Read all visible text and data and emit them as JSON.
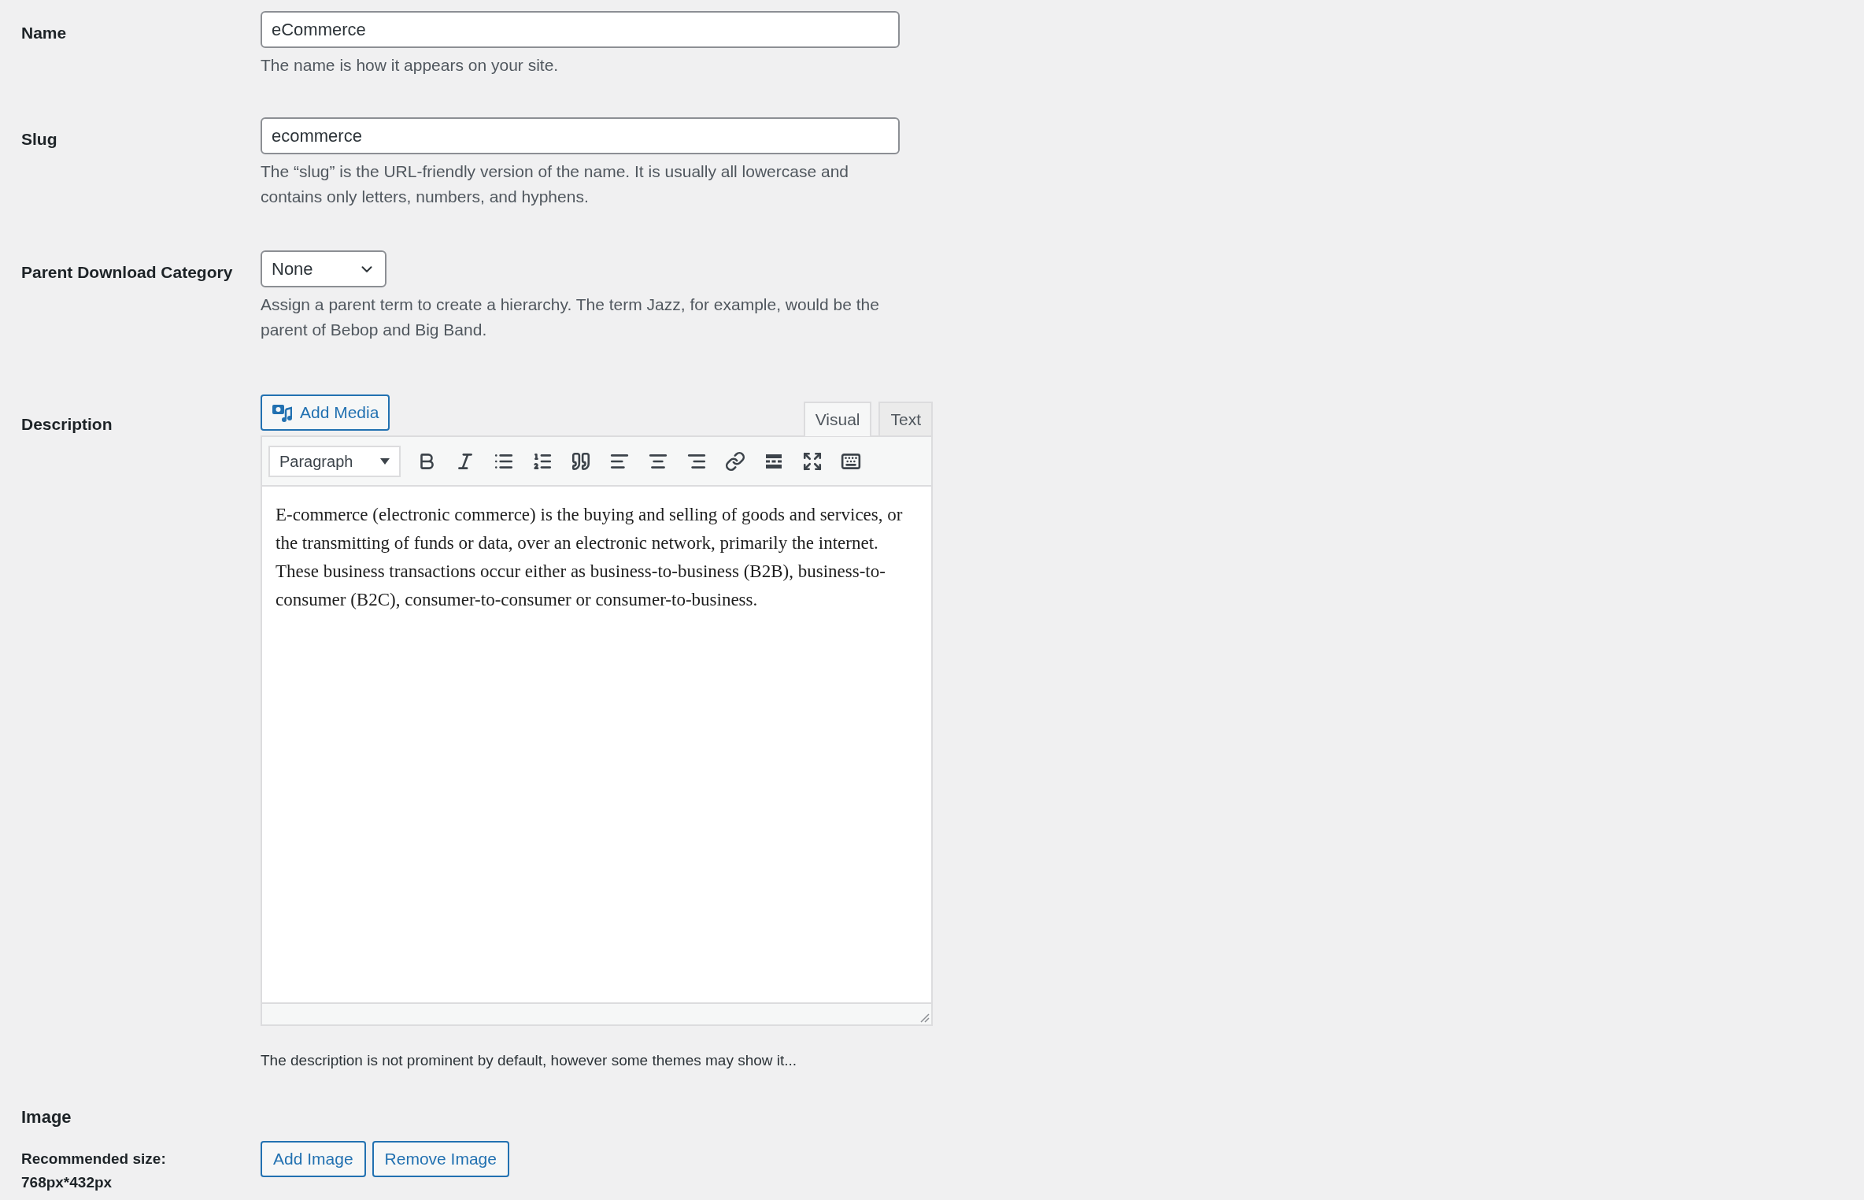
{
  "name": {
    "label": "Name",
    "value": "eCommerce",
    "help": "The name is how it appears on your site."
  },
  "slug": {
    "label": "Slug",
    "value": "ecommerce",
    "help": "The “slug” is the URL-friendly version of the name. It is usually all lowercase and contains only letters, numbers, and hyphens."
  },
  "parent": {
    "label": "Parent Download Category",
    "value": "None",
    "help": "Assign a parent term to create a hierarchy. The term Jazz, for example, would be the parent of Bebop and Big Band."
  },
  "description": {
    "label": "Description",
    "add_media": "Add Media",
    "tabs": [
      {
        "label": "Visual",
        "selected": true
      },
      {
        "label": "Text",
        "selected": false
      }
    ],
    "format": "Paragraph",
    "content": "E-commerce (electronic commerce) is the buying and selling of goods and services, or the transmitting of funds or data, over an electronic network, primarily the internet. These business transactions occur either as business-to-business (B2B), business-to-consumer (B2C), consumer-to-consumer or consumer-to-business.",
    "help": "The description is not prominent by default, however some themes may show it..."
  },
  "image": {
    "label": "Image",
    "hint_lines": [
      "Recommended size:",
      "768px*432px"
    ],
    "buttons": [
      "Add Image",
      "Remove Image"
    ]
  }
}
